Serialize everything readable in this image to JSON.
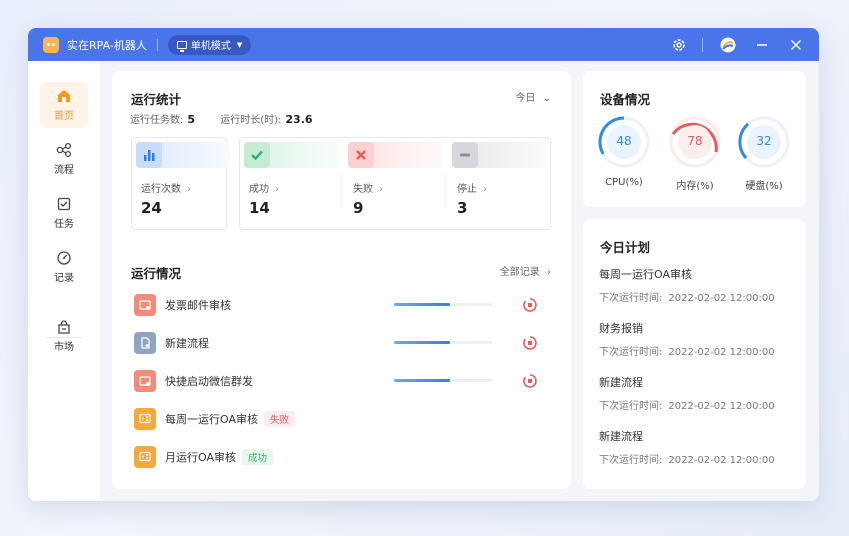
{
  "titlebar": {
    "app_title": "实在RPA-机器人",
    "mode_label": "单机模式",
    "icons": [
      "settings-icon",
      "brand-icon",
      "minimize-icon",
      "close-icon"
    ],
    "accent": "#4a74e9"
  },
  "sidebar": {
    "items": [
      {
        "label": "首页",
        "icon": "home-icon",
        "active": true
      },
      {
        "label": "流程",
        "icon": "flow-icon"
      },
      {
        "label": "任务",
        "icon": "task-icon"
      },
      {
        "label": "记录",
        "icon": "record-icon"
      },
      {
        "label": "市场",
        "icon": "market-icon"
      }
    ],
    "active_color": "#f39a1e"
  },
  "stats": {
    "title": "运行统计",
    "range_label": "今日",
    "task_count_label": "运行任务数:",
    "task_count": "5",
    "duration_label": "运行时长(时):",
    "duration": "23.6",
    "boxes": [
      {
        "label": "运行次数",
        "value": "24",
        "color": "#2f7ee8"
      },
      {
        "label": "成功",
        "value": "14",
        "color": "#2fb36a"
      },
      {
        "label": "失败",
        "value": "9",
        "color": "#e85a5a"
      },
      {
        "label": "停止",
        "value": "3",
        "color": "#8a8f99"
      }
    ]
  },
  "runs": {
    "title": "运行情况",
    "all_records_label": "全部记录",
    "items": [
      {
        "name": "发票邮件审核",
        "status": "running",
        "progress": 0.57
      },
      {
        "name": "新建流程",
        "status": "running",
        "progress": 0.57
      },
      {
        "name": "快捷启动微信群发",
        "status": "running",
        "progress": 0.57
      },
      {
        "name": "每周一运行OA审核",
        "status": "failed",
        "tag": "失败"
      },
      {
        "name": "月运行OA审核",
        "status": "success",
        "tag": "成功"
      }
    ]
  },
  "device": {
    "title": "设备情况",
    "gauges": [
      {
        "label": "CPU(%)",
        "value": "48",
        "color": "#2f8ae8"
      },
      {
        "label": "内存(%)",
        "value": "78",
        "color": "#e85a5a"
      },
      {
        "label": "硬盘(%)",
        "value": "32",
        "color": "#2f8ae8"
      }
    ]
  },
  "plan": {
    "title": "今日计划",
    "time_label": "下次运行时间:",
    "items": [
      {
        "name": "每周一运行OA审核",
        "time": "2022-02-02 12:00:00"
      },
      {
        "name": "财务报销",
        "time": "2022-02-02 12:00:00"
      },
      {
        "name": "新建流程",
        "time": "2022-02-02 12:00:00"
      },
      {
        "name": "新建流程",
        "time": "2022-02-02 12:00:00"
      }
    ]
  }
}
